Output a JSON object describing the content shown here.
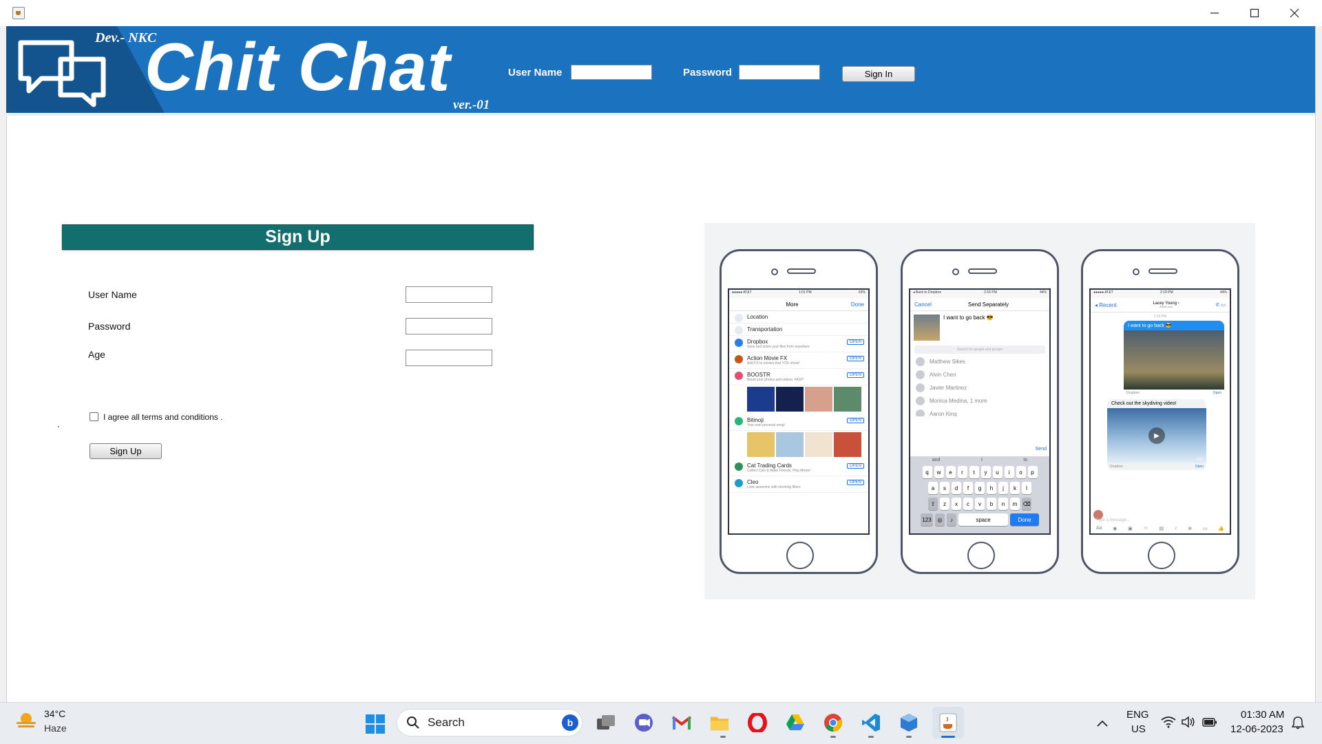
{
  "window": {
    "controls": {
      "minimize": "minimize-icon",
      "maximize": "maximize-icon",
      "close": "close-icon"
    }
  },
  "header": {
    "dev_label": "Dev.- NKC",
    "title": "Chit Chat",
    "version": "ver.-01",
    "username_label": "User Name",
    "username_value": "",
    "password_label": "Password",
    "password_value": "",
    "signin_label": "Sign In",
    "color": "#1b72bf"
  },
  "signup": {
    "title": "Sign Up",
    "fields": [
      {
        "label": "User Name",
        "value": ""
      },
      {
        "label": "Password",
        "value": ""
      },
      {
        "label": "Age",
        "value": ""
      }
    ],
    "terms_label": "I agree all terms and conditions .",
    "terms_checked": false,
    "button_label": "Sign Up",
    "banner_color": "#136e6e"
  },
  "illustration": {
    "phone1": {
      "status_left": "●●●●● AT&T",
      "status_time": "1:01 PM",
      "status_right": "63%",
      "nav_title": "More",
      "nav_done": "Done",
      "rows": [
        {
          "title": "Location",
          "sub": ""
        },
        {
          "title": "Transportation",
          "sub": ""
        },
        {
          "title": "Dropbox",
          "sub": "Save and share your files from anywhere",
          "open": "OPEN"
        },
        {
          "title": "Action Movie FX",
          "sub": "Add FX to movies that YOU shoot!",
          "open": "OPEN"
        },
        {
          "title": "BOOSTR",
          "sub": "Boost your photos and videos. FAST!",
          "open": "OPEN"
        },
        {
          "title": "Bitmoji",
          "sub": "Your own personal emoji",
          "open": "OPEN"
        },
        {
          "title": "Cat Trading Cards",
          "sub": "Collect Cats & Make Friends. Play Meow!",
          "open": "OPEN"
        },
        {
          "title": "Cleo",
          "sub": "Look awesome with stunning filters",
          "open": "OPEN"
        }
      ]
    },
    "phone2": {
      "status_left": "◂ Back to Dropbox",
      "status_time": "2:16 PM",
      "status_right": "44%",
      "nav_cancel": "Cancel",
      "nav_title": "Send Separately",
      "message": "I want to go back 😎",
      "search_placeholder": "Search for people and groups",
      "contacts": [
        "Matthew Sikes",
        "Alvin Chen",
        "Javier Martinez",
        "Monica Medina, 1 more",
        "Aaron King"
      ],
      "send": "Send",
      "suggestions": [
        "and",
        "I",
        "to"
      ],
      "keys_row1": [
        "q",
        "w",
        "e",
        "r",
        "t",
        "y",
        "u",
        "i",
        "o",
        "p"
      ],
      "keys_row2": [
        "a",
        "s",
        "d",
        "f",
        "g",
        "h",
        "j",
        "k",
        "l"
      ],
      "keys_row3": [
        "z",
        "x",
        "c",
        "v",
        "b",
        "n",
        "m"
      ],
      "key_123": "123",
      "key_space": "space",
      "key_done": "Done"
    },
    "phone3": {
      "status_left": "●●●●● AT&T",
      "status_time": "2:19 PM",
      "status_right": "44%",
      "nav_back": "◂ Recent",
      "contact_name": "Lacey Young ›",
      "contact_sub": "Active now",
      "timestamp": "2:19 PM",
      "bubble1": "I want to go back 😎",
      "caption1": "Dropbox",
      "caption1_open": "Open",
      "bubble2": "Check out the skydiving video!",
      "video_time": "0:07",
      "caption2": "Dropbox",
      "caption2_open": "Open",
      "input_placeholder": "Type a message...",
      "composer_label": "Aa"
    }
  },
  "taskbar": {
    "weather_temp": "34°C",
    "weather_desc": "Haze",
    "search_label": "Search",
    "lang": "ENG",
    "region": "US",
    "time": "01:30 AM",
    "date": "12-06-2023"
  }
}
